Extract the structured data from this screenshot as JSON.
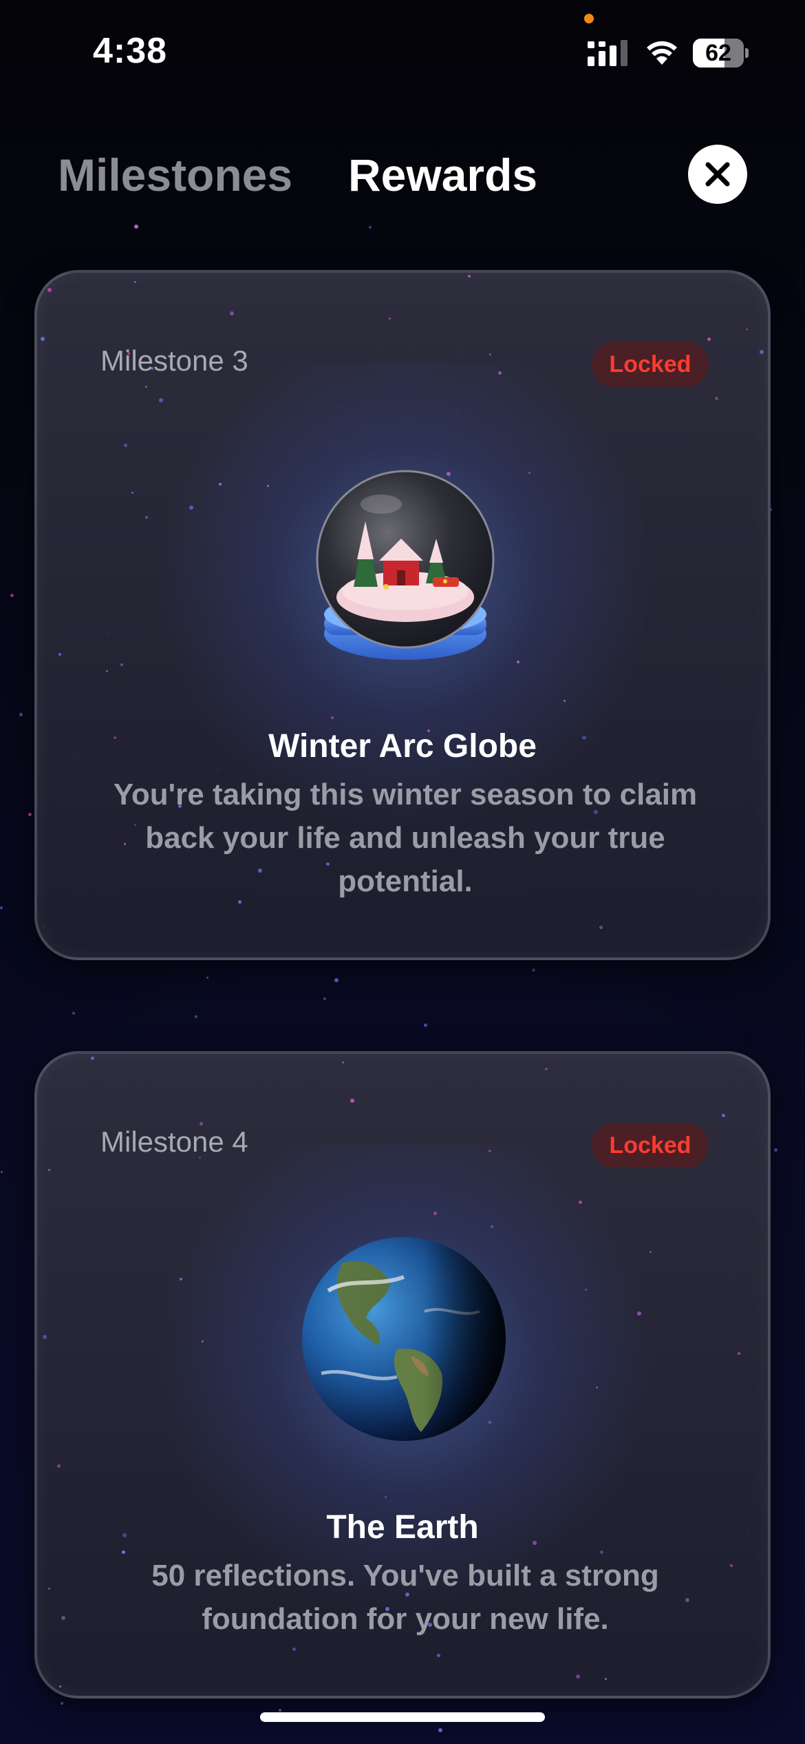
{
  "status_bar": {
    "time": "4:38",
    "battery": "62",
    "battery_level_percent": 62
  },
  "header": {
    "tabs": [
      {
        "label": "Milestones",
        "selected": false
      },
      {
        "label": "Rewards",
        "selected": true
      }
    ],
    "close_icon": "close-x-icon"
  },
  "rewards": [
    {
      "milestone": "Milestone 3",
      "status": "Locked",
      "title": "Winter Arc Globe",
      "description": "You're taking this winter season to claim back your life and unleash your true potential.",
      "image": "snow-globe-image"
    },
    {
      "milestone": "Milestone 4",
      "status": "Locked",
      "title": "The Earth",
      "description": "50 reflections. You've built a strong foundation for your new life.",
      "image": "earth-globe-image"
    }
  ],
  "colors": {
    "background": "#05060f",
    "locked_text": "#ff3b30",
    "locked_bg": "#4a1f25",
    "card_border": "#787890",
    "accent_orange": "#f08a16"
  }
}
